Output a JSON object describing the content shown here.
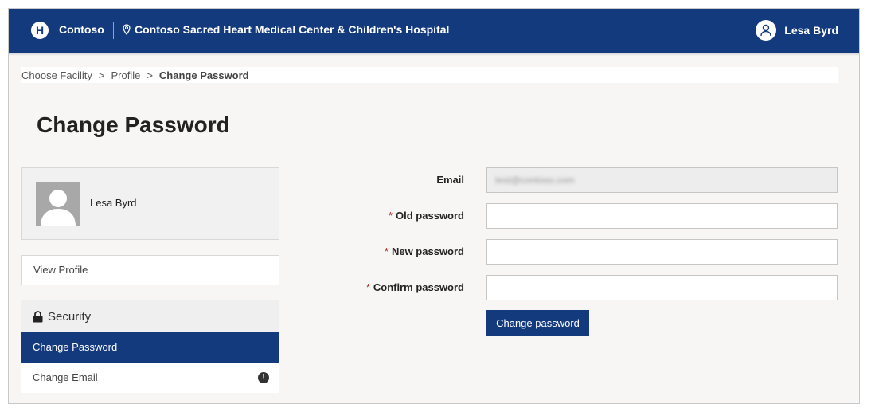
{
  "header": {
    "logo_letter": "H",
    "brand": "Contoso",
    "facility": "Contoso Sacred Heart Medical Center & Children's Hospital",
    "user_name": "Lesa Byrd"
  },
  "breadcrumb": {
    "items": [
      "Choose Facility",
      "Profile"
    ],
    "separator": ">",
    "current": "Change Password"
  },
  "page": {
    "title": "Change Password"
  },
  "profile_card": {
    "name": "Lesa Byrd"
  },
  "sidebar": {
    "view_profile": "View Profile",
    "section_title": "Security",
    "items": [
      {
        "label": "Change Password",
        "active": true
      },
      {
        "label": "Change Email",
        "active": false,
        "icon": "warning-icon"
      }
    ]
  },
  "form": {
    "email_label": "Email",
    "email_value": "test@contoso.com",
    "required_marker": "*",
    "old_password_label": "Old password",
    "new_password_label": "New password",
    "confirm_password_label": "Confirm password",
    "submit_label": "Change password"
  },
  "colors": {
    "brand": "#143a7e",
    "required": "#b2291f"
  }
}
